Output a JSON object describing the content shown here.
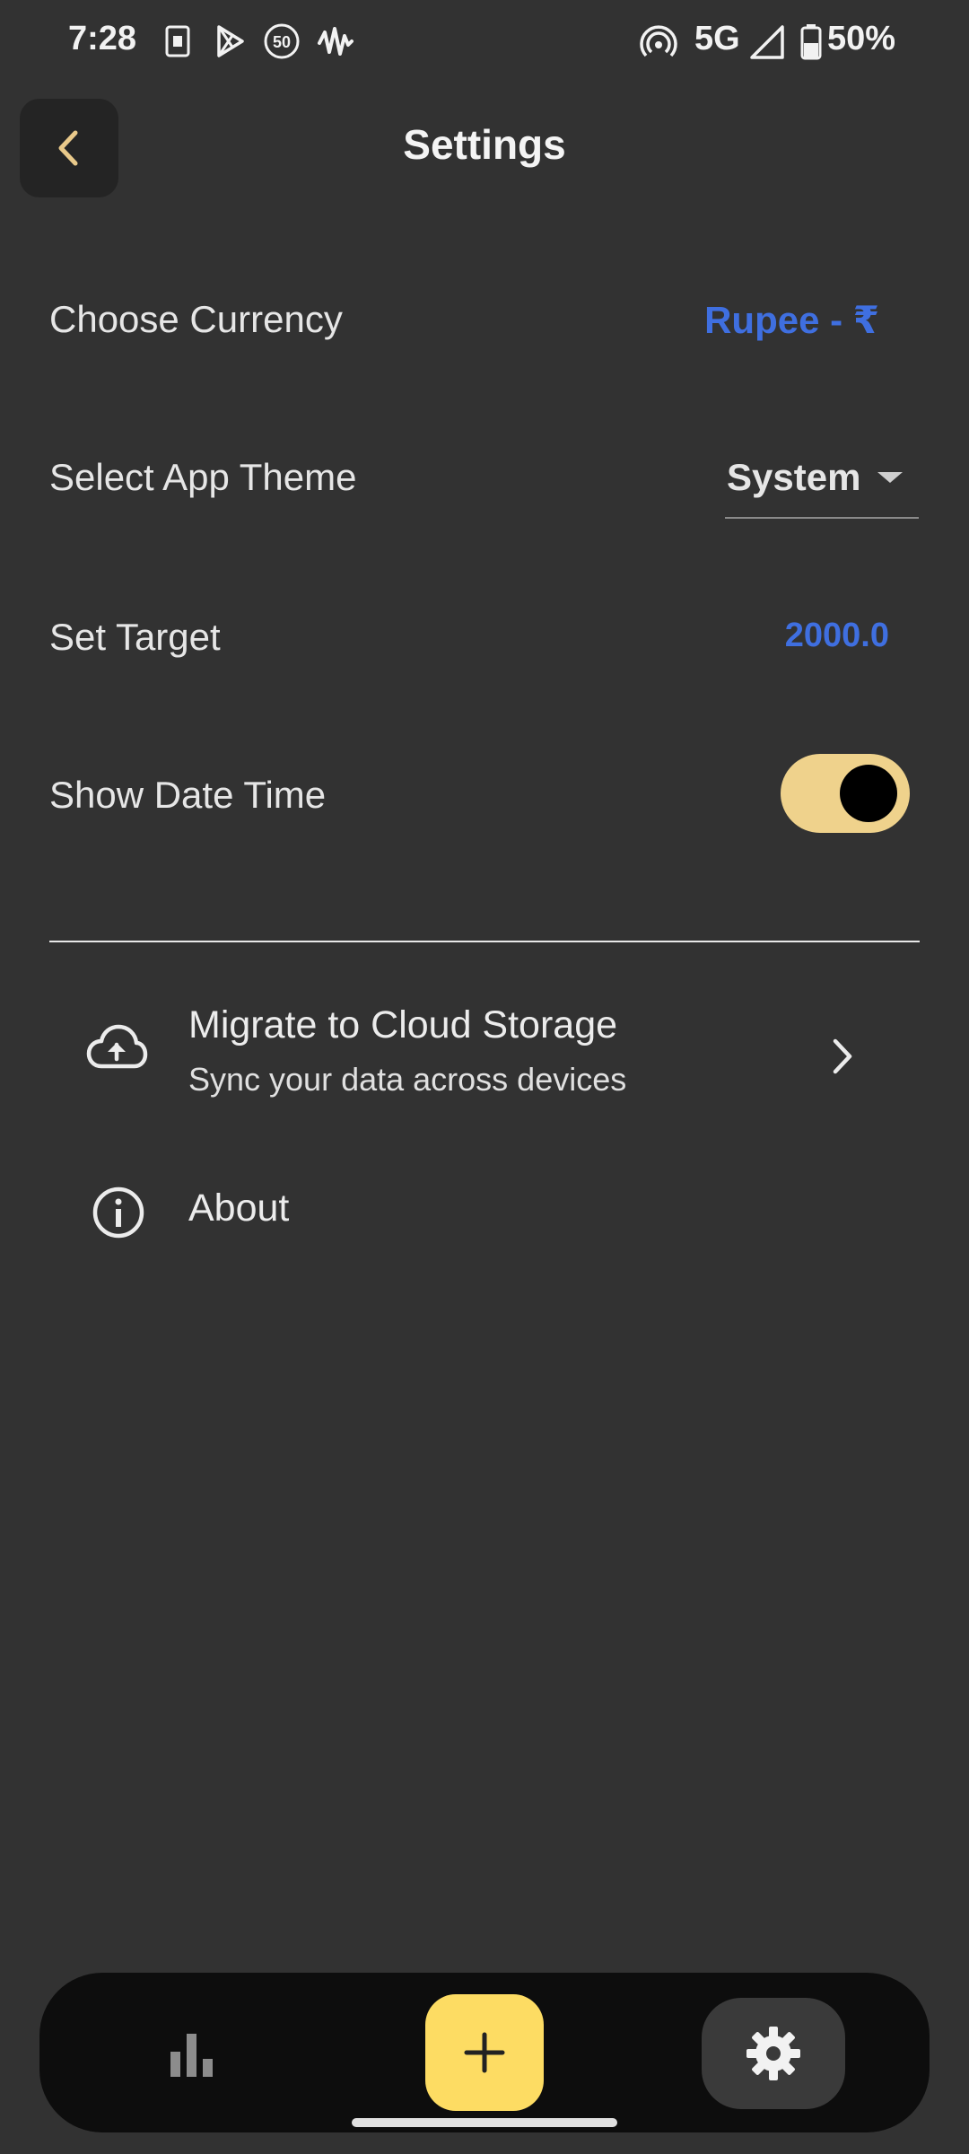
{
  "status_bar": {
    "time": "7:28",
    "network": "5G",
    "battery": "50%",
    "icons": [
      "sim-icon",
      "play-store-icon",
      "fifty-icon",
      "waveform-icon",
      "hotspot-icon",
      "signal-icon",
      "battery-icon"
    ]
  },
  "header": {
    "title": "Settings",
    "back_icon": "back-arrow-icon"
  },
  "settings": {
    "currency": {
      "label": "Choose Currency",
      "value": "Rupee - ₹"
    },
    "theme": {
      "label": "Select App Theme",
      "value": "System"
    },
    "target": {
      "label": "Set Target",
      "value": "2000.0"
    },
    "date_time": {
      "label": "Show Date Time",
      "enabled": true
    }
  },
  "list": {
    "cloud": {
      "title": "Migrate to Cloud Storage",
      "subtitle": "Sync your data across devices",
      "icon": "cloud-upload-icon"
    },
    "about": {
      "title": "About",
      "icon": "info-icon"
    }
  },
  "bottom_nav": {
    "items": [
      "stats-icon",
      "add-icon",
      "settings-icon"
    ]
  },
  "colors": {
    "background": "#323232",
    "accent_blue": "#3f6fe0",
    "toggle_on": "#efd28c",
    "fab_yellow": "#fddc63",
    "back_arrow": "#e9c98a"
  }
}
